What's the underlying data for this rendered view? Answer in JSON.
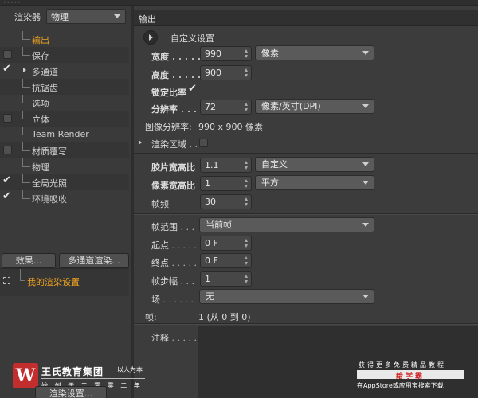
{
  "left_panel": {
    "renderer_label": "渲染器",
    "renderer_value": "物理",
    "items": [
      {
        "label": "输出",
        "checkbox": "none",
        "selected": true,
        "expandable": false
      },
      {
        "label": "保存",
        "checkbox": "unchecked",
        "selected": false,
        "expandable": false
      },
      {
        "label": "多通道",
        "checkbox": "checked",
        "selected": false,
        "expandable": true
      },
      {
        "label": "抗锯齿",
        "checkbox": "none",
        "selected": false,
        "expandable": false
      },
      {
        "label": "选项",
        "checkbox": "none",
        "selected": false,
        "expandable": false
      },
      {
        "label": "立体",
        "checkbox": "unchecked",
        "selected": false,
        "expandable": false
      },
      {
        "label": "Team Render",
        "checkbox": "none",
        "selected": false,
        "expandable": false
      },
      {
        "label": "材质覆写",
        "checkbox": "unchecked",
        "selected": false,
        "expandable": false
      },
      {
        "label": "物理",
        "checkbox": "none",
        "selected": false,
        "expandable": false
      },
      {
        "label": "全局光照",
        "checkbox": "checked",
        "selected": false,
        "expandable": false
      },
      {
        "label": "环境吸收",
        "checkbox": "checked",
        "selected": false,
        "expandable": false
      }
    ],
    "effects_button": "效果...",
    "multipass_button": "多通道渲染...",
    "render_setting_name": "我的渲染设置",
    "render_settings_button": "渲染设置..."
  },
  "right_panel": {
    "title": "输出",
    "custom_settings": "自定义设置",
    "width_label": "宽度",
    "width_value": "990",
    "unit_value": "像素",
    "height_label": "高度",
    "height_value": "900",
    "lock_ratio_label": "锁定比率",
    "lock_ratio_checked": true,
    "resolution_label": "分辨率",
    "resolution_value": "72",
    "resolution_unit": "像素/英寸(DPI)",
    "image_res_label": "图像分辨率:",
    "image_res_value": "990 x 900 像素",
    "render_region_label": "渲染区域",
    "film_aspect_label": "胶片宽高比",
    "film_aspect_value": "1.1",
    "film_aspect_preset": "自定义",
    "pixel_aspect_label": "像素宽高比",
    "pixel_aspect_value": "1",
    "pixel_aspect_preset": "平方",
    "fps_label": "帧频",
    "fps_value": "30",
    "frame_range_label": "帧范围",
    "frame_range_value": "当前帧",
    "start_label": "起点",
    "start_value": "0 F",
    "end_label": "终点",
    "end_value": "0 F",
    "frame_step_label": "帧步幅",
    "frame_step_value": "1",
    "field_label": "场",
    "field_value": "无",
    "frames_label": "帧:",
    "frames_value": "1 (从 0 到 0)",
    "notes_label": "注释"
  },
  "watermark": {
    "logo_glyph": "W",
    "org_name": "王氏教育集团",
    "motto": "以人为本",
    "founded": "始 创 于 二 零 零 二 年",
    "promo_line": "获得更多免费精品教程",
    "brand": "给学霸",
    "download": "在AppStore或应用宝搜索下载"
  },
  "colors": {
    "accent_orange": "#f0a321",
    "panel_bg": "#3c3c3c",
    "logo_red": "#c22d2d"
  }
}
